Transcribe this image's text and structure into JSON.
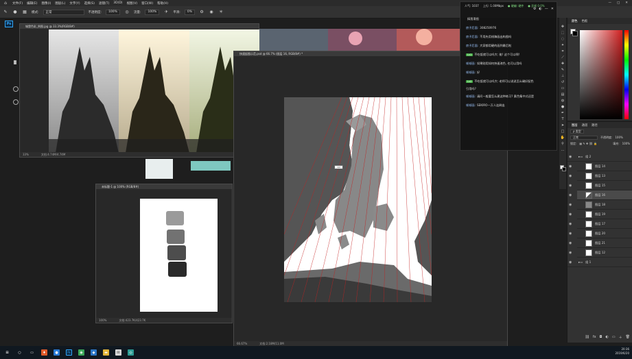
{
  "menubar": {
    "items": [
      "文件(F)",
      "编辑(E)",
      "图像(I)",
      "图层(L)",
      "文字(Y)",
      "选择(S)",
      "滤镜(T)",
      "3D(D)",
      "视图(V)",
      "窗口(W)",
      "帮助(H)"
    ]
  },
  "options": {
    "mode_label": "模式:",
    "mode_value": "正常",
    "opacity_label": "不透明度:",
    "opacity_value": "100%",
    "flow_label": "流量:",
    "flow_value": "100%",
    "smooth_label": "平滑:",
    "smooth_value": "0%"
  },
  "app_logo": "Ps",
  "doc_top": {
    "title": "城堡色彩_例图.jpg @ 33.3%(RGB/8#)",
    "zoom": "33%",
    "status": "文档:4.74M/4.74M"
  },
  "doc_small": {
    "title": "未标题-1 @ 100% (RGB/8#)",
    "zoom": "100%",
    "status": "文档:423.7K/423.7K"
  },
  "doc_main": {
    "title": "快速起图示范.psd @ 66.7% (图层 16, RGB/8#) *",
    "zoom": "66.67%",
    "status": "文档:2.18M/11.0M",
    "label": "1/2"
  },
  "chat": {
    "header": {
      "popularity": "人气: 1037",
      "upload": "上行: 1.00Mbps",
      "hardware": "● 硬编: 硬件",
      "loss": "● 丢帧 0.0%"
    },
    "messages": [
      {
        "name": "",
        "badge": "",
        "text": "搞我滑图"
      },
      {
        "name": "房子后面:",
        "badge": "",
        "text": "308250976"
      },
      {
        "name": "房子后面:",
        "badge": "",
        "text": "不用先用线稿画出构图吗"
      },
      {
        "name": "房子后面:",
        "badge": "",
        "text": "大家都用硬的画到最后啦"
      },
      {
        "name": "",
        "badge": "Lv1",
        "text": "不吃饭就可以吗大:  能! 这个可以啊!"
      },
      {
        "name": "帧帧画:",
        "badge": "",
        "text": "如果刚用如何快速改色, 也可以用吗"
      },
      {
        "name": "帧帧画:",
        "badge": "",
        "text": "好"
      },
      {
        "name": "",
        "badge": "Lv2",
        "text": "不吃饭就可以吗大:  老师可以说说怎么确好配色"
      },
      {
        "name": "",
        "badge": "",
        "text": "引用吗?"
      },
      {
        "name": "帧帧画:",
        "badge": "",
        "text": "请问一般要怎么建这种练习? 素色集中式还是"
      },
      {
        "name": "帧帧画:",
        "badge": "",
        "text": "SEKIRO一万人连刷出"
      }
    ]
  },
  "color_panel": {
    "tabs": [
      "颜色",
      "色板"
    ],
    "fg": "#ffffff",
    "bg": "#000000",
    "accent": "#d02020"
  },
  "layers_panel": {
    "tabs": [
      "图层",
      "通道",
      "路径"
    ],
    "kind_label": "ρ 类型",
    "blend": "正常",
    "opacity_label": "不透明度:",
    "opacity": "100%",
    "lock_label": "锁定:",
    "fill_label": "填充:",
    "fill": "100%",
    "group_top": "组 2",
    "layers": [
      "图层 14",
      "图层 13",
      "图层 15",
      "图层 16",
      "图层 18",
      "图层 19",
      "图层 17",
      "图层 20",
      "图层 21",
      "图层 12"
    ],
    "group_bottom": "组 1"
  },
  "taskbar": {
    "time": "20:36",
    "date": "2019/6/20"
  }
}
